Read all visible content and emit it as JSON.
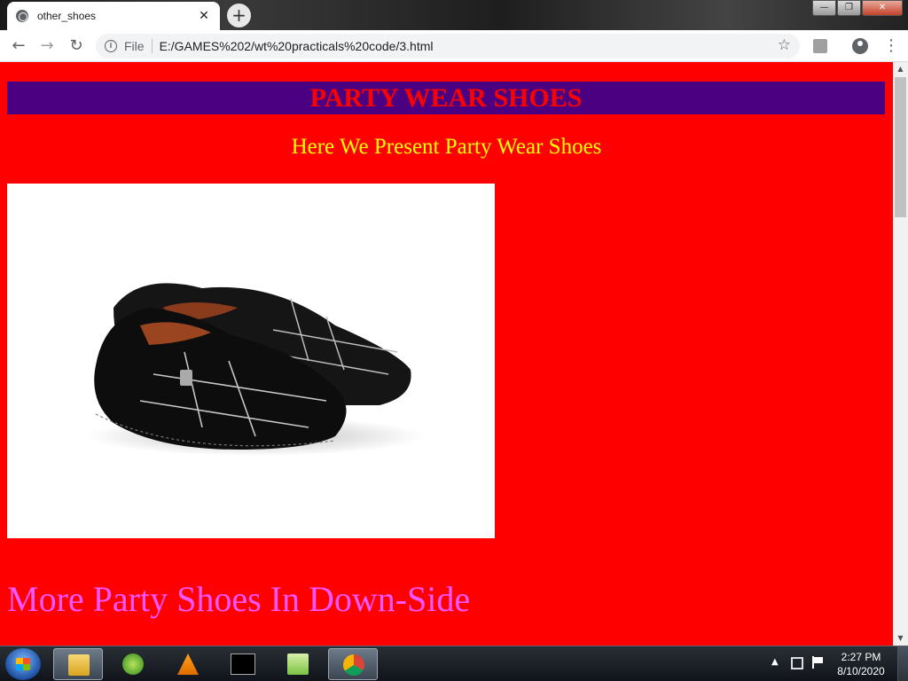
{
  "browser": {
    "tab_title": "other_shoes",
    "tab_close": "✕",
    "new_tab": "+",
    "url_scheme": "File",
    "url": "E:/GAMES%202/wt%20practicals%20code/3.html",
    "win_minimize": "—",
    "win_maximize": "❐",
    "win_close": "✕"
  },
  "page": {
    "heading": "PARTY WEAR SHOES",
    "subtitle": "Here We Present Party Wear Shoes",
    "more_heading": "More Party Shoes In Down-Side",
    "colors": {
      "background": "#ff0000",
      "heading_bar": "#4b0082",
      "heading_text": "#ff0000",
      "subtitle_text": "#ffff00",
      "more_heading_text": "#ff55ff"
    },
    "image_icon": "loafer-shoes-image"
  },
  "taskbar": {
    "time": "2:27 PM",
    "date": "8/10/2020",
    "apps": [
      "file-explorer-icon",
      "windows-media-center-icon",
      "vlc-icon",
      "command-prompt-icon",
      "notepad-plus-plus-icon",
      "chrome-icon"
    ]
  }
}
